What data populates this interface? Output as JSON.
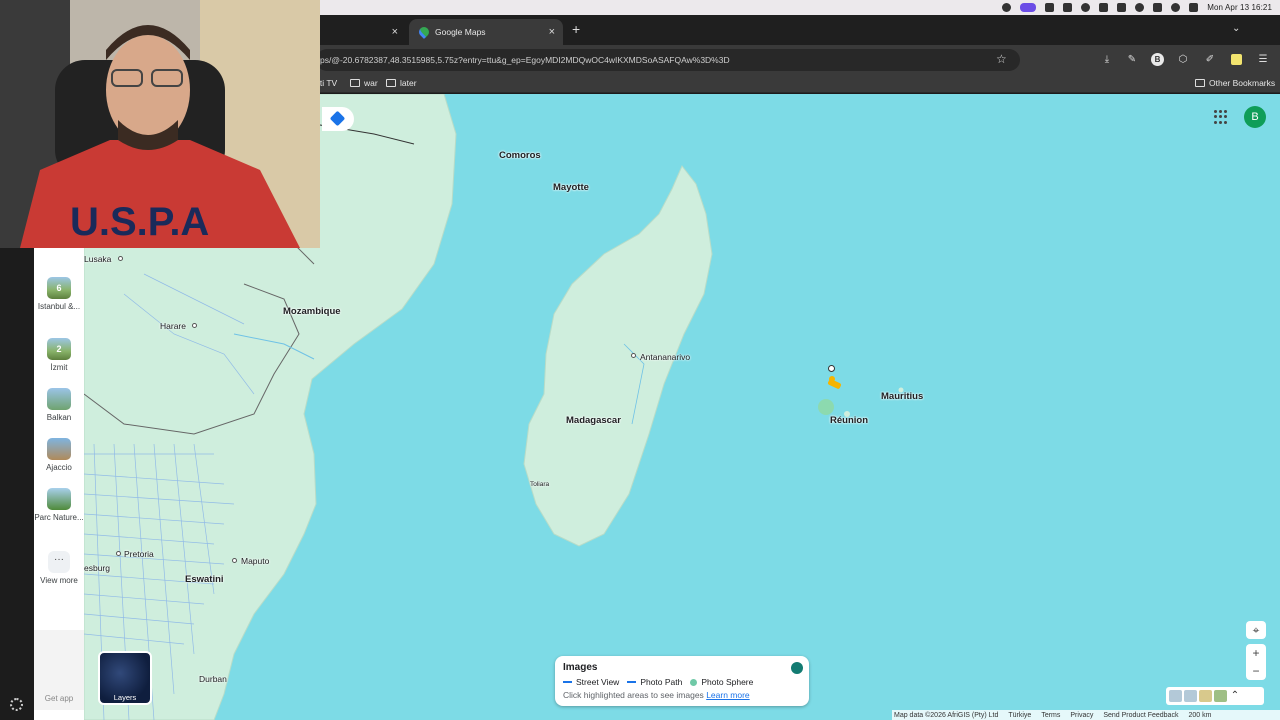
{
  "menubar": {
    "clock": "Mon Apr 13  16:21"
  },
  "tabs": [
    {
      "label": ""
    },
    {
      "label": "Google Maps",
      "active": true
    }
  ],
  "omnibox": {
    "url": "ps/@-20.6782387,48.3515985,5.75z?entry=ttu&g_ep=EgoyMDI2MDQwOC4wIKXMDSoASAFQAw%3D%3D"
  },
  "bookmarks": {
    "items": [
      {
        "label": "iti TV"
      },
      {
        "label": "war"
      },
      {
        "label": "later"
      }
    ],
    "other": "Other Bookmarks"
  },
  "account": {
    "initial": "B"
  },
  "map_labels": {
    "comoros": "Comoros",
    "mayotte": "Mayotte",
    "mozambique": "Mozambique",
    "lusaka": "Lusaka",
    "harare": "Harare",
    "antananarivo": "Antananarivo",
    "madagascar": "Madagascar",
    "toliara": "Toliara",
    "mauritius": "Mauritius",
    "reunion": "Réunion",
    "pretoria": "Pretoria",
    "esburg": "esburg",
    "eswatini": "Eswatini",
    "maputo": "Maputo",
    "durban": "Durban"
  },
  "images_panel": {
    "title": "Images",
    "legend": [
      "Street View",
      "Photo Path",
      "Photo Sphere"
    ],
    "hint": "Click highlighted areas to see images",
    "learn_more": "Learn more"
  },
  "footer": {
    "map_data": "Map data ©2026 AfriGIS (Pty) Ltd",
    "links": [
      "Türkiye",
      "Terms",
      "Privacy",
      "Send Product Feedback"
    ],
    "scale": "200 km"
  },
  "sidebar": {
    "recents": [
      {
        "label": "Istanbul &...",
        "count": "6"
      },
      {
        "label": "İzmit",
        "count": "2"
      },
      {
        "label": "Balkan",
        "count": ""
      },
      {
        "label": "Ajaccio",
        "count": ""
      },
      {
        "label": "Parc Nature...",
        "count": ""
      }
    ],
    "view_more": "View more",
    "get_app": "Get app",
    "layers": "Layers"
  },
  "colors": {
    "water": "#7ddbe6",
    "land": "#cfeedd",
    "account": "#0f9d58",
    "accent": "#1a73e8"
  }
}
